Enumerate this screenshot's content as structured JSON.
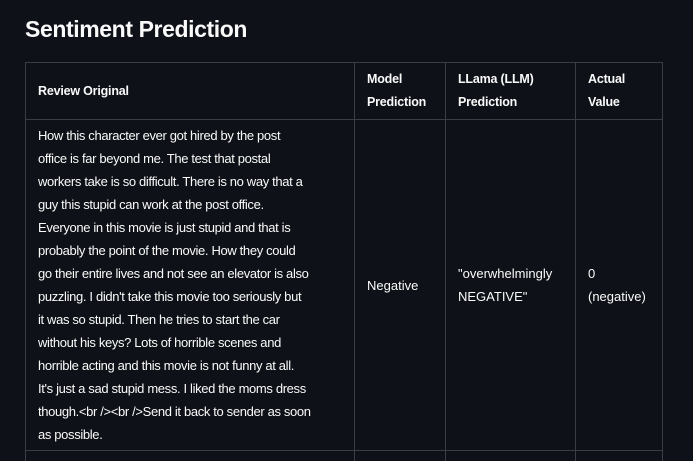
{
  "title": "Sentiment Prediction",
  "table": {
    "headers": [
      "Review Original",
      "Model Prediction",
      "LLama (LLM) Prediction",
      "Actual Value"
    ],
    "header_lines": {
      "model": [
        "Model",
        "Prediction"
      ],
      "llama": [
        "LLama (LLM)",
        "Prediction"
      ],
      "actual": [
        "Actual",
        "Value"
      ]
    },
    "rows": [
      {
        "review_lines": [
          "How this character ever got hired by the post",
          "office is far beyond me. The test that postal",
          "workers take is so difficult. There is no way that a",
          "guy this stupid can work at the post office.",
          "Everyone in this movie is just stupid and that is",
          "probably the point of the movie. How they could",
          "go their entire lives and not see an elevator is also",
          "puzzling. I didn't take this movie too seriously but",
          "it was so stupid. Then he tries to start the car",
          "without his keys? Lots of horrible scenes and",
          "horrible acting and this movie is not funny at all.",
          "It's just a sad stupid mess. I liked the moms dress",
          "though.<br /><br />Send it back to sender as soon",
          "as possible."
        ],
        "model_prediction": "Negative",
        "llama_lines": [
          "\"overwhelmingly",
          "NEGATIVE\""
        ],
        "actual_lines": [
          "0",
          "(negative)"
        ]
      }
    ]
  }
}
